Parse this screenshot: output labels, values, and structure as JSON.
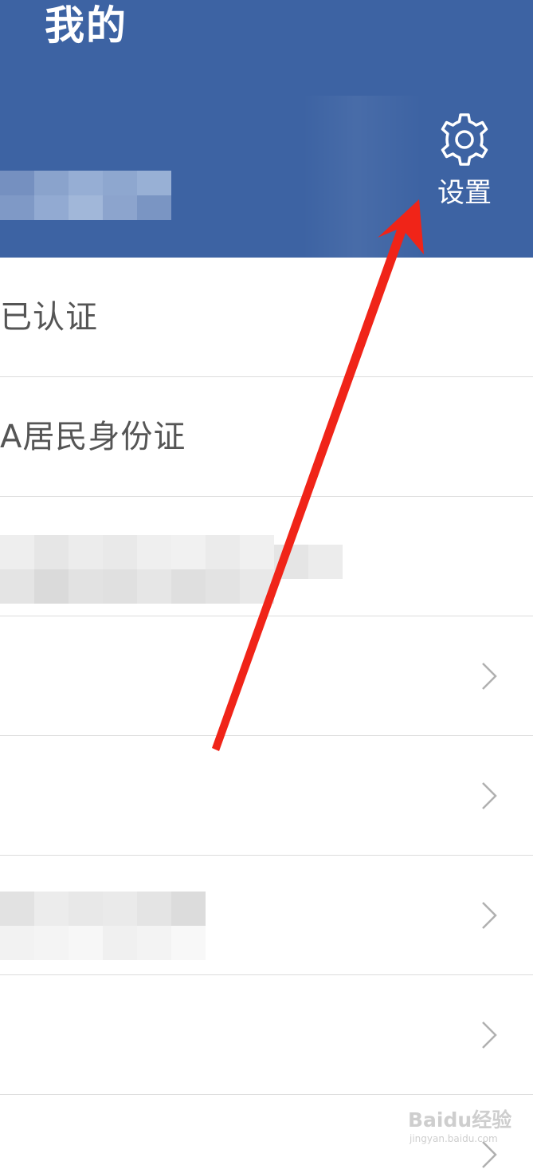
{
  "header": {
    "title": "我的",
    "settings_label": "设置",
    "background_color": "#3d63a3"
  },
  "rows": [
    {
      "label": "已认证",
      "has_chevron": false
    },
    {
      "label": "A居民身份证",
      "has_chevron": false
    },
    {
      "label": "",
      "has_chevron": false,
      "redacted": true
    },
    {
      "label": "",
      "has_chevron": true
    },
    {
      "label": "",
      "has_chevron": true
    },
    {
      "label": "",
      "has_chevron": true,
      "redacted": true
    },
    {
      "label": "",
      "has_chevron": true
    },
    {
      "label": "",
      "has_chevron": true
    }
  ],
  "icons": [
    "gear-icon",
    "chevron-right-icon",
    "arrow-annotation"
  ],
  "annotation_color": "#f02418",
  "watermark": {
    "brand": "Baidu经验",
    "url": "jingyan.baidu.com"
  }
}
